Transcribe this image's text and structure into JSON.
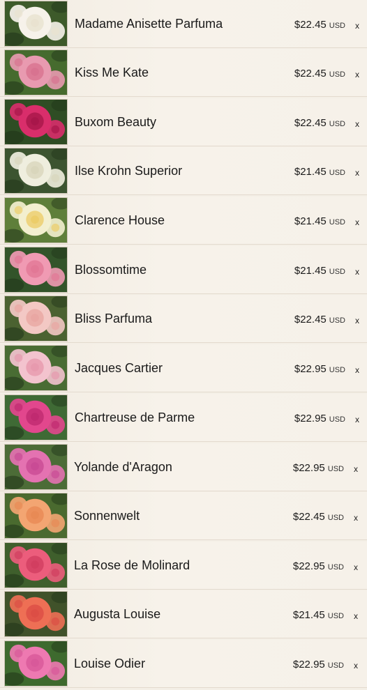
{
  "cart": {
    "currency_label": "USD",
    "remove_glyph": "x",
    "items": [
      {
        "name": "Madame Anisette Parfuma",
        "price": "$22.45",
        "petal": "#f6f2ea",
        "center": "#e9e2d0",
        "leaf": "#3d5a2a"
      },
      {
        "name": "Kiss Me Kate",
        "price": "$22.45",
        "petal": "#e89ab0",
        "center": "#d87390",
        "leaf": "#466b2e"
      },
      {
        "name": "Buxom Beauty",
        "price": "$22.45",
        "petal": "#d92e6b",
        "center": "#a8164a",
        "leaf": "#2f4d24"
      },
      {
        "name": "Ilse Krohn Superior",
        "price": "$21.45",
        "petal": "#efeede",
        "center": "#d9d6bc",
        "leaf": "#3c5430"
      },
      {
        "name": "Clarence House",
        "price": "$21.45",
        "petal": "#f3efcf",
        "center": "#eccd6a",
        "leaf": "#5f7f3a"
      },
      {
        "name": "Blossomtime",
        "price": "$21.45",
        "petal": "#f09ab3",
        "center": "#e27896",
        "leaf": "#33542a"
      },
      {
        "name": "Bliss Parfuma",
        "price": "$22.45",
        "petal": "#f3c8c4",
        "center": "#e9a7a3",
        "leaf": "#4b6231"
      },
      {
        "name": "Jacques Cartier",
        "price": "$22.95",
        "petal": "#f3c3ce",
        "center": "#e79aae",
        "leaf": "#496c33"
      },
      {
        "name": "Chartreuse de Parme",
        "price": "$22.95",
        "petal": "#e2478d",
        "center": "#c02a70",
        "leaf": "#3f6a35"
      },
      {
        "name": "Yolande d'Aragon",
        "price": "$22.95",
        "petal": "#e472b1",
        "center": "#c94b95",
        "leaf": "#4c6c37"
      },
      {
        "name": "Sonnenwelt",
        "price": "$22.45",
        "petal": "#f3a572",
        "center": "#e88a55",
        "leaf": "#4a6a2f"
      },
      {
        "name": "La Rose de Molinard",
        "price": "$22.95",
        "petal": "#ec5d7c",
        "center": "#d23e60",
        "leaf": "#3f5f2c"
      },
      {
        "name": "Augusta Louise",
        "price": "$21.45",
        "petal": "#ee6f55",
        "center": "#dc4e45",
        "leaf": "#40522a"
      },
      {
        "name": "Louise Odier",
        "price": "$22.95",
        "petal": "#ee79b1",
        "center": "#d8599a",
        "leaf": "#3e6a2e"
      }
    ]
  }
}
